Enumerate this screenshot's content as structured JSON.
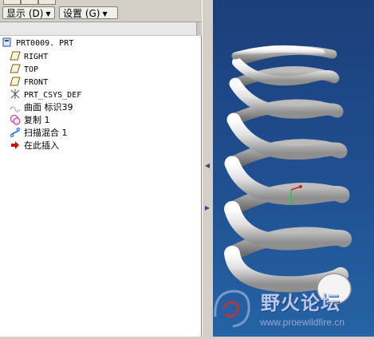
{
  "toolbar": {
    "display_label": "显示 (D)",
    "settings_label": "设置 (G)"
  },
  "tree": {
    "root": "PRT0009. PRT",
    "items": [
      {
        "label": "RIGHT",
        "icon": "datum-plane-icon"
      },
      {
        "label": "TOP",
        "icon": "datum-plane-icon"
      },
      {
        "label": "FRONT",
        "icon": "datum-plane-icon"
      },
      {
        "label": "PRT_CSYS_DEF",
        "icon": "coordinate-system-icon"
      },
      {
        "label": "曲面 标识39",
        "icon": "surface-icon"
      },
      {
        "label": "复制 1",
        "icon": "copy-feature-icon"
      },
      {
        "label": "扫描混合 1",
        "icon": "swept-blend-icon"
      },
      {
        "label": "在此插入",
        "icon": "insert-here-icon"
      }
    ]
  },
  "watermark": {
    "title": "野火论坛",
    "url": "www.proewildfire.cn"
  },
  "colors": {
    "viewport_top": "#1b3f7a",
    "viewport_bottom": "#2563a5",
    "spring": "#e6e6e6",
    "insert_arrow": "#cc1111"
  }
}
